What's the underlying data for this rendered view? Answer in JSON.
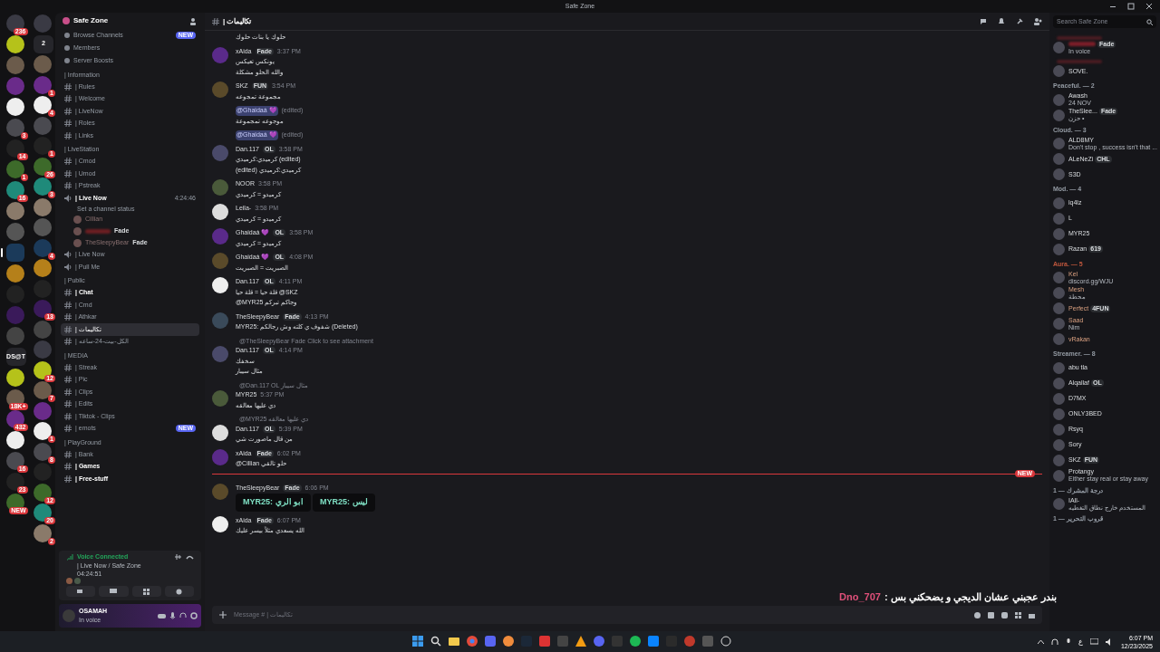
{
  "window": {
    "title": "Safe Zone"
  },
  "rail_left": [
    {
      "kind": "server",
      "selected": false,
      "badge": "236"
    },
    {
      "kind": "server",
      "selected": false
    },
    {
      "kind": "server",
      "selected": false
    },
    {
      "kind": "server",
      "selected": false
    },
    {
      "kind": "server",
      "selected": false
    },
    {
      "kind": "server",
      "selected": false,
      "badge": "3"
    },
    {
      "kind": "server",
      "selected": false,
      "badge": "14"
    },
    {
      "kind": "server",
      "selected": false,
      "badge": "1"
    },
    {
      "kind": "server",
      "selected": false,
      "badge": "16"
    },
    {
      "kind": "server",
      "selected": false
    },
    {
      "kind": "server",
      "selected": false
    },
    {
      "kind": "server",
      "selected": true
    },
    {
      "kind": "server",
      "selected": false
    },
    {
      "kind": "server",
      "selected": false
    },
    {
      "kind": "server",
      "selected": false
    },
    {
      "kind": "server",
      "selected": false
    },
    {
      "kind": "folder",
      "selected": false,
      "label": "DS@T"
    },
    {
      "kind": "server",
      "selected": false
    },
    {
      "kind": "server",
      "selected": false,
      "badge": "18K+"
    },
    {
      "kind": "server",
      "selected": false,
      "badge": "432"
    },
    {
      "kind": "server",
      "selected": false
    },
    {
      "kind": "server",
      "selected": false,
      "badge": "16"
    },
    {
      "kind": "server",
      "selected": false,
      "badge": "23"
    },
    {
      "kind": "server",
      "selected": false,
      "badge": "NEW"
    }
  ],
  "rail_right": [
    {
      "kind": "server"
    },
    {
      "kind": "folder",
      "label": "2"
    },
    {
      "kind": "server"
    },
    {
      "kind": "server",
      "badge": "1"
    },
    {
      "kind": "server",
      "badge": "4"
    },
    {
      "kind": "server"
    },
    {
      "kind": "server",
      "badge": "1"
    },
    {
      "kind": "server",
      "badge": "26"
    },
    {
      "kind": "server",
      "badge": "3"
    },
    {
      "kind": "server"
    },
    {
      "kind": "server"
    },
    {
      "kind": "server",
      "badge": "4"
    },
    {
      "kind": "server"
    },
    {
      "kind": "server"
    },
    {
      "kind": "server",
      "badge": "13"
    },
    {
      "kind": "server"
    },
    {
      "kind": "server"
    },
    {
      "kind": "server",
      "badge": "12"
    },
    {
      "kind": "server",
      "badge": "7"
    },
    {
      "kind": "server"
    },
    {
      "kind": "server",
      "badge": "1"
    },
    {
      "kind": "server",
      "badge": "8"
    },
    {
      "kind": "server"
    },
    {
      "kind": "server",
      "badge": "12"
    },
    {
      "kind": "server",
      "badge": "20"
    },
    {
      "kind": "server",
      "badge": "2"
    }
  ],
  "sidebar": {
    "server_name": "Safe Zone",
    "top_items": [
      {
        "label": "Browse Channels",
        "badge": "NEW"
      },
      {
        "label": "Members"
      },
      {
        "label": "Server Boosts"
      }
    ],
    "categories": [
      {
        "name": "| Information",
        "channels": [
          {
            "name": "| Rules",
            "kind": "text",
            "selected": false,
            "unread": false
          },
          {
            "name": "| Welcome",
            "kind": "text",
            "selected": false,
            "unread": false
          },
          {
            "name": "| LiveNow",
            "kind": "text",
            "selected": false,
            "unread": false
          },
          {
            "name": "| Roles",
            "kind": "text",
            "selected": false,
            "unread": false
          },
          {
            "name": "| Links",
            "kind": "text",
            "selected": false,
            "unread": false
          }
        ]
      },
      {
        "name": "| LiveStation",
        "channels": [
          {
            "name": "| Cmod",
            "kind": "text",
            "selected": false,
            "unread": false
          },
          {
            "name": "| Umod",
            "kind": "text",
            "selected": false,
            "unread": false
          },
          {
            "name": "| Pstreak",
            "kind": "text",
            "selected": false,
            "unread": false
          },
          {
            "name": "| Live Now",
            "kind": "voice",
            "selected": false,
            "unread": true,
            "timer": "4:24:46",
            "status": "Set a channel status",
            "users": [
              {
                "name": "Cillian"
              },
              {
                "tag": "Fade"
              },
              {
                "name": "TheSleepyBear",
                "tag": "Fade"
              }
            ]
          },
          {
            "name": "| Live Now",
            "kind": "voice",
            "selected": false,
            "unread": false
          },
          {
            "name": "| Pull Me",
            "kind": "voice",
            "selected": false,
            "unread": false
          }
        ]
      },
      {
        "name": "| Public",
        "channels": [
          {
            "name": "| Chat",
            "kind": "text",
            "selected": false,
            "unread": true
          },
          {
            "name": "| Cmd",
            "kind": "text",
            "selected": false,
            "unread": false
          },
          {
            "name": "| Athkar",
            "kind": "text",
            "selected": false,
            "unread": false
          },
          {
            "name": "| تكاليمات",
            "kind": "text",
            "selected": true,
            "unread": false
          },
          {
            "name": "| الكل-بيت-24-ساعه",
            "kind": "text",
            "selected": false,
            "unread": false
          }
        ]
      },
      {
        "name": "| MEDIA",
        "channels": [
          {
            "name": "| Streak",
            "kind": "text",
            "selected": false,
            "unread": false
          },
          {
            "name": "| Pic",
            "kind": "text",
            "selected": false,
            "unread": false
          },
          {
            "name": "| Clips",
            "kind": "text",
            "selected": false,
            "unread": false
          },
          {
            "name": "| Edits",
            "kind": "text",
            "selected": false,
            "unread": false
          },
          {
            "name": "| Tiktok - Clips",
            "kind": "text",
            "selected": false,
            "unread": false
          },
          {
            "name": "| emots",
            "kind": "text",
            "selected": false,
            "unread": false,
            "badge": "NEW"
          }
        ]
      },
      {
        "name": "| PlayGround",
        "channels": [
          {
            "name": "| Bank",
            "kind": "text",
            "selected": false,
            "unread": false
          },
          {
            "name": "| Games",
            "kind": "text",
            "selected": false,
            "unread": true
          },
          {
            "name": "| Free-stuff",
            "kind": "text",
            "selected": false,
            "unread": true
          }
        ]
      }
    ]
  },
  "voice_panel": {
    "title": "Voice Connected",
    "channel": "| Live Now / Safe Zone",
    "timer": "04:24:51"
  },
  "user_panel": {
    "name": "OSAMAH",
    "status": "In voice"
  },
  "chat": {
    "channel": "| تكاليمات",
    "search_placeholder": "Search Safe Zone",
    "input_placeholder": "Message # | تكاليمات",
    "messages": [
      {
        "lines": [
          "حلوك يا بنات حلوك"
        ]
      },
      {
        "author": "xAida",
        "tag": "Fade",
        "time": "3:37 PM",
        "lines": [
          "يونكس تعيكس",
          "والله الحلو مشكلة"
        ]
      },
      {
        "author": "SKZ",
        "tag": "FUN",
        "time": "3:54 PM",
        "lines": [
          "مجموعة تمجوعه"
        ]
      },
      {
        "mention": "@Ghaidaá 💜",
        "edited": "(edited)",
        "lines": [
          "موجوعه تمجموعة"
        ]
      },
      {
        "mention": "@Ghaidaá 💜",
        "edited": "(edited)"
      },
      {
        "author": "Dan.117",
        "tag": "OL",
        "time": "3:58 PM",
        "lines": [
          "كرميدي:كرميدي (edited)",
          "(edited) كرميدي:كرميدي"
        ]
      },
      {
        "author": "NOOR",
        "time": "3:58 PM",
        "lines": [
          "كرميدو = كرميدي"
        ]
      },
      {
        "author": "Leila-",
        "time": "3:58 PM",
        "lines": [
          "كرميدو = كرميدي"
        ]
      },
      {
        "author": "Ghaidaá 💜",
        "tag": "OL",
        "time": "3:58 PM",
        "lines": [
          "كرميدو = كرميدي"
        ]
      },
      {
        "author": "Ghaidaá 💜",
        "tag": "OL",
        "time": "4:08 PM",
        "lines": [
          "الصبريت = الصبريت"
        ]
      },
      {
        "author": "Dan.117",
        "tag": "OL",
        "time": "4:11 PM",
        "lines": [
          "قلة حيا = قلة حيا @SKZ",
          "@MYR25 وجاكم تبركم"
        ]
      },
      {
        "author": "TheSleepyBear",
        "tag": "Fade",
        "time": "4:13 PM",
        "lines": [
          "MYR25: شفوف ي كلته وش رجالكم (Deleted)"
        ]
      },
      {
        "reply": "@TheSleepyBear  Fade  Click to see attachment",
        "author": "Dan.117",
        "tag": "OL",
        "time": "4:14 PM",
        "lines": [
          "سخفك",
          "مثال سيبار"
        ]
      },
      {
        "reply": "@Dan.117  OL  مثال سيبار",
        "author": "MYR25",
        "time": "5:37 PM",
        "lines": [
          "دي عليها معالقه"
        ]
      },
      {
        "reply": "@MYR25 دي عليها معالقه",
        "author": "Dan.117",
        "tag": "OL",
        "time": "5:39 PM",
        "lines": [
          "من قال ماصورت شي"
        ]
      },
      {
        "author": "xAida",
        "tag": "Fade",
        "time": "6:02 PM",
        "lines": [
          "@Cillian حلو تالقي"
        ]
      },
      {
        "author": "TheSleepyBear",
        "tag": "Fade",
        "time": "6:06 PM",
        "new_divider": "NEW",
        "embeds": [
          "MYR25: ابو الري",
          "MYR25: ليس"
        ]
      },
      {
        "author": "xAida",
        "tag": "Fade",
        "time": "6:07 PM",
        "lines": [
          "الله يسعدي مثلاً بيسر عليك"
        ]
      }
    ]
  },
  "members": [
    {
      "members": [
        {
          "tag": "Fade",
          "status": "In voice"
        }
      ]
    },
    {
      "members": [
        {
          "name": "SOVE."
        }
      ]
    },
    {
      "header": "Peaceful. — 2",
      "members": [
        {
          "name": "Awash",
          "status": "24 NOV"
        },
        {
          "name": "TheSlee...",
          "tag": "Fade",
          "status": "حزن •"
        }
      ]
    },
    {
      "header": "Cloud. — 3",
      "members": [
        {
          "name": "ALD8MY",
          "status": "Don't stop , success isn't that ..."
        },
        {
          "name": "ALeNeZi",
          "tag": "CHL"
        },
        {
          "name": "S3D"
        }
      ]
    },
    {
      "header": "Mod. — 4",
      "members": [
        {
          "name": "lq4lz"
        },
        {
          "name": "L"
        },
        {
          "name": "MYR25"
        },
        {
          "name": "Razan",
          "tag": "619"
        }
      ]
    },
    {
      "header": "Aura. — 5",
      "color": "#c0573d",
      "members": [
        {
          "name": "Kel",
          "status": "discord.gg/WJU"
        },
        {
          "name": "Mesh",
          "status": "محطة"
        },
        {
          "name": "Perfect",
          "tag": "4FUN"
        },
        {
          "name": "Saad",
          "status": "Nim"
        },
        {
          "name": "vRakan"
        }
      ]
    },
    {
      "header": "Streamer. — 8",
      "members": [
        {
          "name": "abu tla"
        },
        {
          "name": "Alqallaf",
          "tag": "OL"
        },
        {
          "name": "D7MX"
        },
        {
          "name": "ONLY3BED"
        },
        {
          "name": "Rsyq"
        },
        {
          "name": "Sory"
        },
        {
          "name": "SKZ",
          "tag": "FUN"
        },
        {
          "name": "Protangy",
          "status": "Either stay real or stay away"
        }
      ]
    },
    {
      "header": "درجة المشرك — 1",
      "members": [
        {
          "name": "IAll-",
          "status": "المستخدم خارج نطاق التغطيه"
        }
      ]
    },
    {
      "header": "قروب التحرير — 1"
    }
  ],
  "overlay": {
    "message": "بندر عجبني عشان الديجي و يضحكني بس :",
    "author": "Dno_707"
  },
  "taskbar": {
    "language": "ع",
    "time": "6:07 PM",
    "date": "12/23/2025"
  }
}
